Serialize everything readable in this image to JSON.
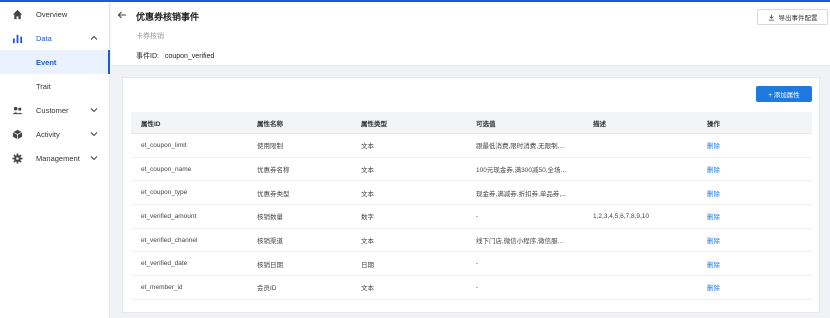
{
  "sidebar": {
    "items": [
      {
        "label": "Overview",
        "icon": "home-icon"
      },
      {
        "label": "Data",
        "icon": "bar-chart-icon"
      },
      {
        "label": "Event"
      },
      {
        "label": "Trait"
      },
      {
        "label": "Customer",
        "icon": "users-icon"
      },
      {
        "label": "Activity",
        "icon": "cube-icon"
      },
      {
        "label": "Management",
        "icon": "gear-icon"
      }
    ]
  },
  "header": {
    "title": "优惠券核销事件",
    "subtitle": "卡券核销",
    "event_id_label": "事件ID:",
    "event_id_value": "coupon_verified",
    "export_label": "导出事件配置"
  },
  "card": {
    "add_label": "+ 添加属性"
  },
  "table": {
    "headers": [
      "属性ID",
      "属性名称",
      "属性类型",
      "可选值",
      "描述",
      "操作"
    ],
    "rows": [
      [
        "et_coupon_limit",
        "使用限制",
        "文本",
        "跟最低消费,限时消费,无限制,...",
        "",
        "删除"
      ],
      [
        "et_coupon_name",
        "优惠券名称",
        "文本",
        "100元现金券,满300减50,全场...",
        "",
        "删除"
      ],
      [
        "et_coupon_type",
        "优惠券类型",
        "文本",
        "现金券,满减券,折扣券,单品券,...",
        "",
        "删除"
      ],
      [
        "et_verified_amount",
        "核销数量",
        "数字",
        "-",
        "1,2,3,4,5,6,7,8,9,10",
        "删除"
      ],
      [
        "et_verified_channel",
        "核销渠道",
        "文本",
        "线下门店,微信小程序,微信服...",
        "",
        "删除"
      ],
      [
        "et_verified_date",
        "核销日期",
        "日期",
        "-",
        "",
        "删除"
      ],
      [
        "et_member_id",
        "会员ID",
        "文本",
        "-",
        "",
        "删除"
      ]
    ]
  },
  "colors": {
    "accent": "#1f5ad1",
    "button": "#1f7ae0"
  }
}
